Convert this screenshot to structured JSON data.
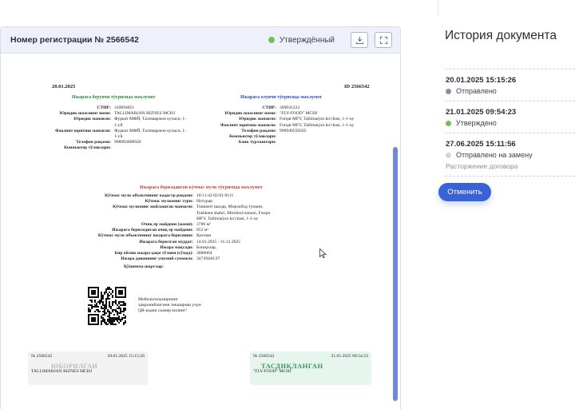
{
  "card": {
    "title": "Номер регистрации № 2566542",
    "status": "Утверждённый",
    "status_color": "#72c157",
    "download_icon": "download-icon",
    "expand_icon": "expand-icon"
  },
  "document": {
    "date": "20.01.2025",
    "id_label": "ID 2566542",
    "lessor_section": "Ижарага берувчи тўғрисида маълумот",
    "lessee_section": "Ижарага олувчи тўғрисида маълумот",
    "lessor": [
      {
        "k": "СТИР:",
        "v": "310894851"
      },
      {
        "k": "Юридик шахснинг номи:",
        "v": "TALLIMARJAN BIZNES MCHJ"
      },
      {
        "k": "Юридик манзили:",
        "v": "Фуркат МФЙ, Талимаржон кучаси, 1-1-уй"
      },
      {
        "k": "Фаолият юритиш манзили:",
        "v": "Фуркат МФЙ, Талимаржон кучаси, 1-1-уй"
      },
      {
        "k": "Телефон рақами:",
        "v": "998983008920"
      },
      {
        "k": "Компьютер тўловлари:",
        "v": ""
      }
    ],
    "lessee": [
      {
        "k": "СТИР:",
        "v": "309041222"
      },
      {
        "k": "Юридик шахснинг номи:",
        "v": "\"FLY-FOOD\" MCHJ"
      },
      {
        "k": "Юридик манзили:",
        "v": "Furqat MFY, Tallimarjon ko'chasi, 1-1-uy"
      },
      {
        "k": "Фаолият юритиш манзили:",
        "v": "Furqat MFY, Tallimarjon ko'chasi, 1-1-uy"
      },
      {
        "k": "Телефон рақами:",
        "v": "998940550505"
      },
      {
        "k": "Компьютер тўловлари:",
        "v": ""
      },
      {
        "k": "Банк турлаштари:",
        "v": ""
      }
    ],
    "property_section": "Ижарага бериладиган кўчмас мулк тўғрисида маълумот",
    "property": [
      {
        "k": "Кўчмас мулк объектининг кадастр рақами:",
        "v": "10:11:42:02:01:0111"
      },
      {
        "k": "Кўчмас мулкнинг тури:",
        "v": "Нотурар"
      },
      {
        "k": "Кўчмас мулкнинг жойлашган манзили:",
        "v": "Тошкент шаҳар, Мирзобод тумани, Toshkent shahri, Mirobod tumani, Furqat MFY, Tallimarjon ko'chasi, 1-1-uy"
      },
      {
        "k": "Очиқ ер майдони (жами):",
        "v": "3786 м²"
      },
      {
        "k": "Ижарага бериладиган очиқ ер майдони:",
        "v": "852 м²"
      },
      {
        "k": "Кўчмас мулк объектининг ижарага берилиши:",
        "v": "Қисман"
      },
      {
        "k": "Ижарага берилган муддат:",
        "v": "14.01.2025 - 31.12.2025"
      },
      {
        "k": "Ижара мақсади:",
        "v": "Бошқалар,"
      },
      {
        "k": "Бир ойлик ижара ҳақи тўлови (сўмда):",
        "v": "3000064"
      },
      {
        "k": "Ижара давоннинг умумий суммаси:",
        "v": "34749446.97"
      }
    ],
    "extra_terms": "Қўшимча шартлар:",
    "qr_note": "Мобильтильмирнинг ҳаққонийлигини текшириш учун QR-кодни скaнер килинг!",
    "sig_left": {
      "num": "№ 2566542",
      "date": "20.01.2025 15:15:26",
      "stamp": "ЮБОРИЛГАН",
      "org": "TALLIMARJAN BIZNES MCHJ"
    },
    "sig_right": {
      "num": "№ 2566542",
      "date": "21.01.2025 09:54:23",
      "stamp": "ТАСДИҚЛАНГАН",
      "org": "\"FLY-FOOD\" MCHJ"
    }
  },
  "history": {
    "title": "История документа",
    "items": [
      {
        "time": "20.01.2025 15:15:26",
        "status": "Отправлено",
        "color": "#8e8ea6",
        "note": ""
      },
      {
        "time": "21.01.2025 09:54:23",
        "status": "Утверждено",
        "color": "#72c157",
        "note": ""
      },
      {
        "time": "27.06.2025 15:11:56",
        "status": "Отправлено на замену",
        "color": "#d6d6d6",
        "note": "Расторжение договора"
      }
    ],
    "cancel_label": "Отменить"
  }
}
